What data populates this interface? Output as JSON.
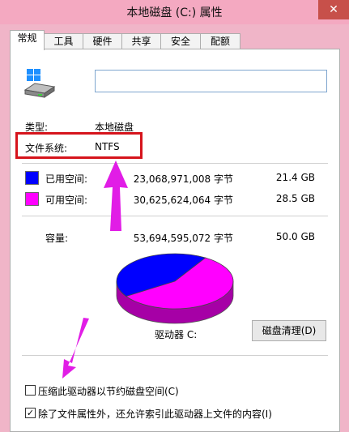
{
  "window": {
    "title": "本地磁盘 (C:) 属性",
    "close_glyph": "✕"
  },
  "tabs": [
    {
      "label": "常规",
      "active": true
    },
    {
      "label": "工具"
    },
    {
      "label": "硬件"
    },
    {
      "label": "共享"
    },
    {
      "label": "安全"
    },
    {
      "label": "配额"
    }
  ],
  "general": {
    "volume_name_value": "",
    "type_label": "类型:",
    "type_value": "本地磁盘",
    "fs_label": "文件系统:",
    "fs_value": "NTFS"
  },
  "usage": {
    "used_label": "已用空间:",
    "used_bytes": "23,068,971,008 字节",
    "used_size": "21.4 GB",
    "used_color": "#0000ff",
    "free_label": "可用空间:",
    "free_bytes": "30,625,624,064 字节",
    "free_size": "28.5 GB",
    "free_color": "#ff00ff",
    "cap_label": "容量:",
    "cap_bytes": "53,694,595,072 字节",
    "cap_size": "50.0 GB",
    "used_fraction": 0.4296
  },
  "drive": {
    "label": "驱动器 C:",
    "cleanup_button": "磁盘清理(D)"
  },
  "options": {
    "compress_label": "压缩此驱动器以节约磁盘空间(C)",
    "compress_checked": false,
    "index_label": "除了文件属性外，还允许索引此驱动器上文件的内容(I)",
    "index_checked": true,
    "check_glyph": "✓"
  },
  "annotations": {
    "arrow_color": "#e11de6",
    "highlight_color": "#d6141c"
  }
}
